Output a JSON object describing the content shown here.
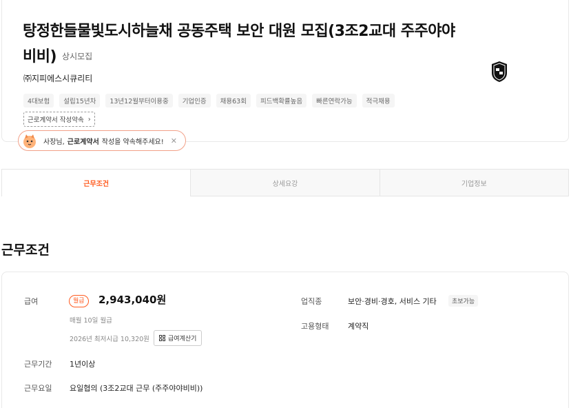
{
  "header": {
    "title": "탕정한들물빛도시하늘채 공동주택 보안 대원 모집(3조2교대 주주야야비비)",
    "status": "상시모집",
    "company": "㈜지피에스시큐리티",
    "tags": [
      "4대보험",
      "설립15년차",
      "13년12월부터이용중",
      "기업인증",
      "채용63회",
      "피드백확률높음",
      "빠른연락가능",
      "적극채용"
    ],
    "contract_tag": "근로계약서 작성약속",
    "bubble": {
      "prefix": "사장님,",
      "bold": "근로계약서",
      "suffix": "작성을 약속해주세요!"
    }
  },
  "tabs": [
    {
      "label": "근무조건",
      "active": true
    },
    {
      "label": "상세요강",
      "active": false
    },
    {
      "label": "기업정보",
      "active": false
    }
  ],
  "section_title": "근무조건",
  "conditions": {
    "pay_label": "급여",
    "pay_badge": "월급",
    "pay_amount": "2,943,040원",
    "pay_day": "매월 10일 월급",
    "min_wage": "2026년 최저시급 10,320원",
    "calc_button": "급여계산기",
    "period_label": "근무기간",
    "period_value": "1년이상",
    "days_label": "근무요일",
    "days_value": "요일협의 (3조2교대 근무 (주주야야비비))",
    "industry_label": "업직종",
    "industry_value": "보안·경비·경호, 서비스 기타",
    "industry_tag": "초보가능",
    "employment_label": "고용형태",
    "employment_value": "계약직"
  },
  "colors": {
    "accent": "#ff5a1f",
    "border": "#e8e8e8"
  }
}
